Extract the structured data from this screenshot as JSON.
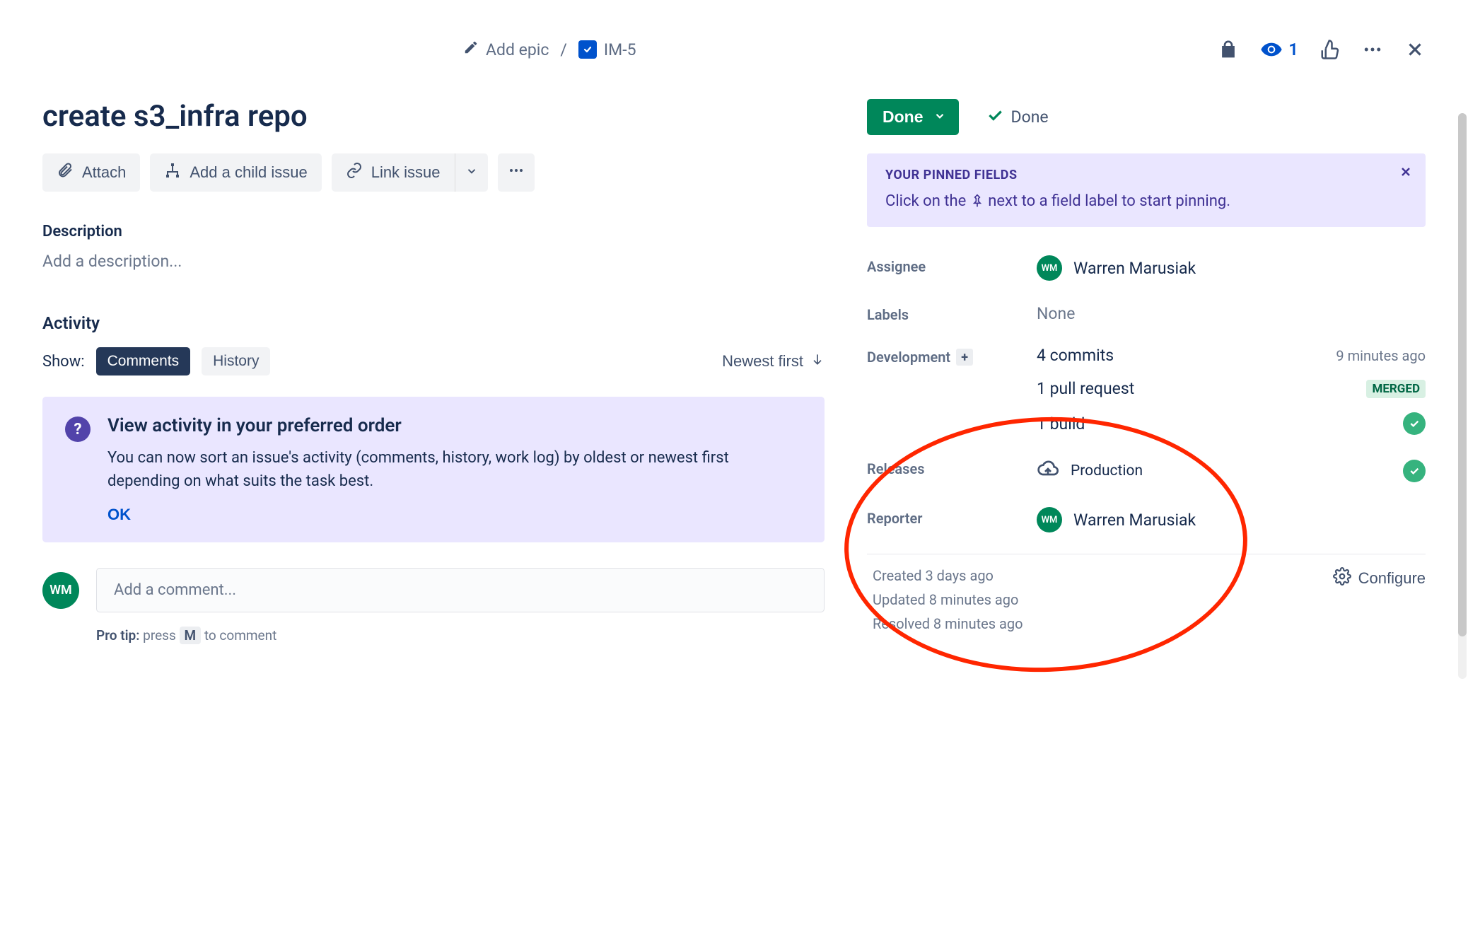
{
  "breadcrumb": {
    "add_epic": "Add epic",
    "issue_key": "IM-5"
  },
  "topbar": {
    "watchers": "1"
  },
  "issue": {
    "title": "create s3_infra repo"
  },
  "actions": {
    "attach": "Attach",
    "add_child": "Add a child issue",
    "link_issue": "Link issue"
  },
  "description": {
    "label": "Description",
    "placeholder": "Add a description..."
  },
  "activity": {
    "label": "Activity",
    "show": "Show:",
    "comments": "Comments",
    "history": "History",
    "sort": "Newest first"
  },
  "banner": {
    "title": "View activity in your preferred order",
    "body": "You can now sort an issue's activity (comments, history, work log) by oldest or newest first depending on what suits the task best.",
    "ok": "OK"
  },
  "comment": {
    "placeholder": "Add a comment...",
    "protip_label": "Pro tip:",
    "protip_press": "press",
    "protip_key": "M",
    "protip_rest": "to comment"
  },
  "status": {
    "current": "Done",
    "resolution": "Done"
  },
  "pinned": {
    "title": "YOUR PINNED FIELDS",
    "hint_before": "Click on the ",
    "hint_after": " next to a field label to start pinning."
  },
  "fields": {
    "assignee_label": "Assignee",
    "assignee_name": "Warren Marusiak",
    "assignee_initials": "WM",
    "labels_label": "Labels",
    "labels_value": "None",
    "development_label": "Development",
    "commits": "4 commits",
    "commits_time": "9 minutes ago",
    "prs": "1 pull request",
    "merged": "MERGED",
    "builds": "1 build",
    "releases_label": "Releases",
    "release_name": "Production",
    "reporter_label": "Reporter",
    "reporter_name": "Warren Marusiak",
    "reporter_initials": "WM"
  },
  "meta": {
    "created": "Created 3 days ago",
    "updated": "Updated 8 minutes ago",
    "resolved": "Resolved 8 minutes ago",
    "configure": "Configure"
  },
  "avatar_initials": "WM"
}
